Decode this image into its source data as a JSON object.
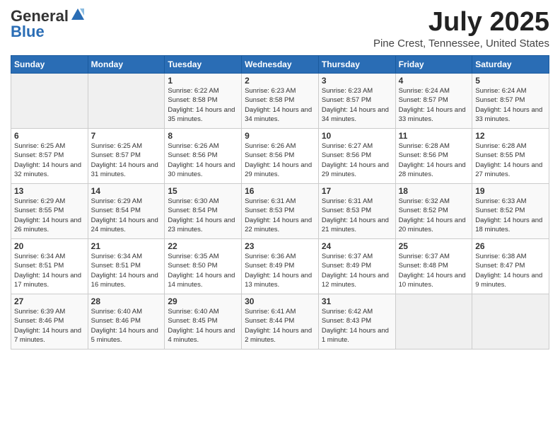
{
  "logo": {
    "general": "General",
    "blue": "Blue"
  },
  "title": "July 2025",
  "subtitle": "Pine Crest, Tennessee, United States",
  "days_of_week": [
    "Sunday",
    "Monday",
    "Tuesday",
    "Wednesday",
    "Thursday",
    "Friday",
    "Saturday"
  ],
  "weeks": [
    [
      {
        "day": "",
        "info": ""
      },
      {
        "day": "",
        "info": ""
      },
      {
        "day": "1",
        "info": "Sunrise: 6:22 AM\nSunset: 8:58 PM\nDaylight: 14 hours and 35 minutes."
      },
      {
        "day": "2",
        "info": "Sunrise: 6:23 AM\nSunset: 8:58 PM\nDaylight: 14 hours and 34 minutes."
      },
      {
        "day": "3",
        "info": "Sunrise: 6:23 AM\nSunset: 8:57 PM\nDaylight: 14 hours and 34 minutes."
      },
      {
        "day": "4",
        "info": "Sunrise: 6:24 AM\nSunset: 8:57 PM\nDaylight: 14 hours and 33 minutes."
      },
      {
        "day": "5",
        "info": "Sunrise: 6:24 AM\nSunset: 8:57 PM\nDaylight: 14 hours and 33 minutes."
      }
    ],
    [
      {
        "day": "6",
        "info": "Sunrise: 6:25 AM\nSunset: 8:57 PM\nDaylight: 14 hours and 32 minutes."
      },
      {
        "day": "7",
        "info": "Sunrise: 6:25 AM\nSunset: 8:57 PM\nDaylight: 14 hours and 31 minutes."
      },
      {
        "day": "8",
        "info": "Sunrise: 6:26 AM\nSunset: 8:56 PM\nDaylight: 14 hours and 30 minutes."
      },
      {
        "day": "9",
        "info": "Sunrise: 6:26 AM\nSunset: 8:56 PM\nDaylight: 14 hours and 29 minutes."
      },
      {
        "day": "10",
        "info": "Sunrise: 6:27 AM\nSunset: 8:56 PM\nDaylight: 14 hours and 29 minutes."
      },
      {
        "day": "11",
        "info": "Sunrise: 6:28 AM\nSunset: 8:56 PM\nDaylight: 14 hours and 28 minutes."
      },
      {
        "day": "12",
        "info": "Sunrise: 6:28 AM\nSunset: 8:55 PM\nDaylight: 14 hours and 27 minutes."
      }
    ],
    [
      {
        "day": "13",
        "info": "Sunrise: 6:29 AM\nSunset: 8:55 PM\nDaylight: 14 hours and 26 minutes."
      },
      {
        "day": "14",
        "info": "Sunrise: 6:29 AM\nSunset: 8:54 PM\nDaylight: 14 hours and 24 minutes."
      },
      {
        "day": "15",
        "info": "Sunrise: 6:30 AM\nSunset: 8:54 PM\nDaylight: 14 hours and 23 minutes."
      },
      {
        "day": "16",
        "info": "Sunrise: 6:31 AM\nSunset: 8:53 PM\nDaylight: 14 hours and 22 minutes."
      },
      {
        "day": "17",
        "info": "Sunrise: 6:31 AM\nSunset: 8:53 PM\nDaylight: 14 hours and 21 minutes."
      },
      {
        "day": "18",
        "info": "Sunrise: 6:32 AM\nSunset: 8:52 PM\nDaylight: 14 hours and 20 minutes."
      },
      {
        "day": "19",
        "info": "Sunrise: 6:33 AM\nSunset: 8:52 PM\nDaylight: 14 hours and 18 minutes."
      }
    ],
    [
      {
        "day": "20",
        "info": "Sunrise: 6:34 AM\nSunset: 8:51 PM\nDaylight: 14 hours and 17 minutes."
      },
      {
        "day": "21",
        "info": "Sunrise: 6:34 AM\nSunset: 8:51 PM\nDaylight: 14 hours and 16 minutes."
      },
      {
        "day": "22",
        "info": "Sunrise: 6:35 AM\nSunset: 8:50 PM\nDaylight: 14 hours and 14 minutes."
      },
      {
        "day": "23",
        "info": "Sunrise: 6:36 AM\nSunset: 8:49 PM\nDaylight: 14 hours and 13 minutes."
      },
      {
        "day": "24",
        "info": "Sunrise: 6:37 AM\nSunset: 8:49 PM\nDaylight: 14 hours and 12 minutes."
      },
      {
        "day": "25",
        "info": "Sunrise: 6:37 AM\nSunset: 8:48 PM\nDaylight: 14 hours and 10 minutes."
      },
      {
        "day": "26",
        "info": "Sunrise: 6:38 AM\nSunset: 8:47 PM\nDaylight: 14 hours and 9 minutes."
      }
    ],
    [
      {
        "day": "27",
        "info": "Sunrise: 6:39 AM\nSunset: 8:46 PM\nDaylight: 14 hours and 7 minutes."
      },
      {
        "day": "28",
        "info": "Sunrise: 6:40 AM\nSunset: 8:46 PM\nDaylight: 14 hours and 5 minutes."
      },
      {
        "day": "29",
        "info": "Sunrise: 6:40 AM\nSunset: 8:45 PM\nDaylight: 14 hours and 4 minutes."
      },
      {
        "day": "30",
        "info": "Sunrise: 6:41 AM\nSunset: 8:44 PM\nDaylight: 14 hours and 2 minutes."
      },
      {
        "day": "31",
        "info": "Sunrise: 6:42 AM\nSunset: 8:43 PM\nDaylight: 14 hours and 1 minute."
      },
      {
        "day": "",
        "info": ""
      },
      {
        "day": "",
        "info": ""
      }
    ]
  ]
}
